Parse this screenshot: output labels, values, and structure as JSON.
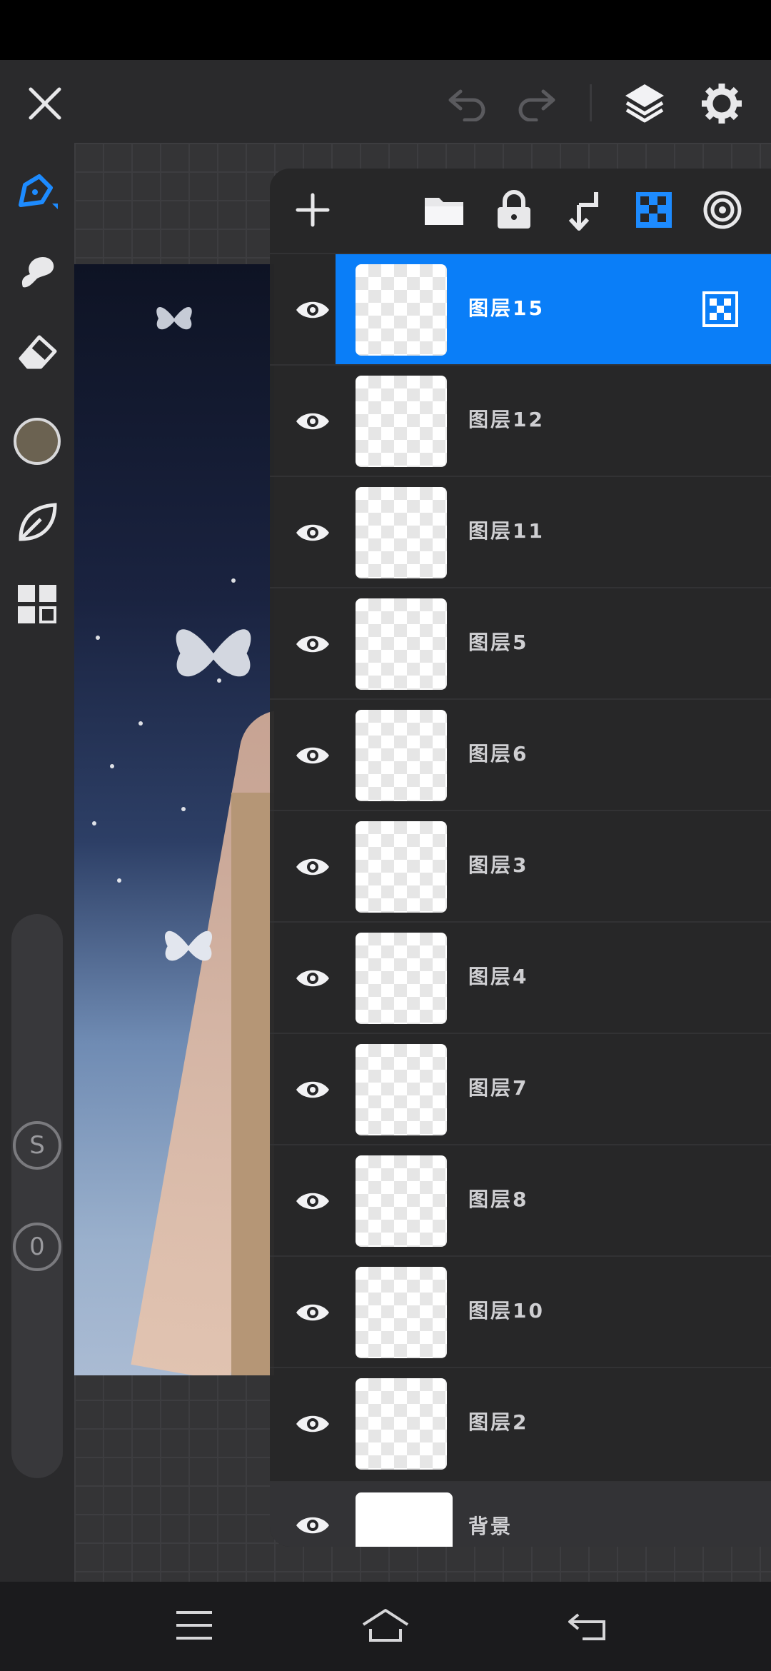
{
  "toolbar": {
    "close_icon": "close-icon",
    "undo_icon": "undo-icon",
    "redo_icon": "redo-icon",
    "layers_icon": "layers-icon",
    "settings_icon": "gear-icon"
  },
  "tools": [
    {
      "name": "pencil-tool",
      "icon": "pencil-icon",
      "active": true
    },
    {
      "name": "smudge-tool",
      "icon": "smudge-icon"
    },
    {
      "name": "eraser-tool",
      "icon": "eraser-icon"
    },
    {
      "name": "color-swatch",
      "color": "#6b6251"
    },
    {
      "name": "leaf-tool",
      "icon": "leaf-icon"
    },
    {
      "name": "grid-tool",
      "icon": "grid-icon"
    }
  ],
  "sliders": {
    "size_label": "S",
    "opacity_label": "0"
  },
  "layer_panel": {
    "header_icons": [
      "add-icon",
      "folder-icon",
      "lock-icon",
      "merge-down-icon",
      "alpha-lock-icon",
      "blend-icon"
    ],
    "layers": [
      {
        "name": "图层15",
        "active": true
      },
      {
        "name": "图层12"
      },
      {
        "name": "图层11"
      },
      {
        "name": "图层5"
      },
      {
        "name": "图层6"
      },
      {
        "name": "图层3"
      },
      {
        "name": "图层4"
      },
      {
        "name": "图层7"
      },
      {
        "name": "图层8"
      },
      {
        "name": "图层10"
      },
      {
        "name": "图层2"
      }
    ],
    "background_layer": "背景"
  },
  "colors": {
    "accent": "#0a7ef8",
    "panel": "#262628",
    "toolbar": "#2a2a2c"
  },
  "navbar": {
    "icons": [
      "menu-icon",
      "home-icon",
      "back-icon"
    ]
  }
}
